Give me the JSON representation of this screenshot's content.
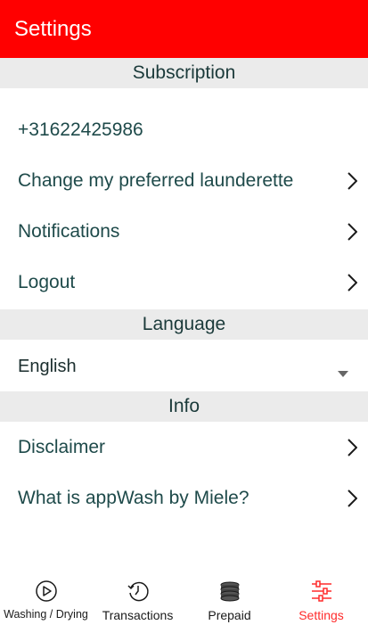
{
  "header": {
    "title": "Settings"
  },
  "sections": {
    "subscription": "Subscription",
    "language": "Language",
    "info": "Info"
  },
  "subscription": {
    "phone": "+31622425986",
    "change_launderette": "Change my preferred launderette",
    "notifications": "Notifications",
    "logout": "Logout"
  },
  "language": {
    "selected": "English"
  },
  "info": {
    "disclaimer": "Disclaimer",
    "about": "What is appWash by Miele?"
  },
  "tabs": [
    {
      "label": "Washing / Drying",
      "icon": "play-circle-icon"
    },
    {
      "label": "Transactions",
      "icon": "history-clock-icon"
    },
    {
      "label": "Prepaid",
      "icon": "coins-icon"
    },
    {
      "label": "Settings",
      "icon": "sliders-icon",
      "active": true
    }
  ],
  "colors": {
    "primary": "#ff0000",
    "section_bg": "#ebebeb",
    "text": "#1e4a4a",
    "active_tab": "#ff2b2b"
  }
}
